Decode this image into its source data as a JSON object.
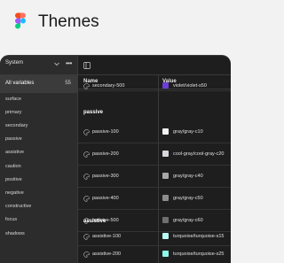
{
  "header": {
    "title": "Themes",
    "logo": "figma-logo"
  },
  "sidebar": {
    "collection": "System",
    "more": "•••",
    "all_variables": {
      "label": "All variables",
      "count": "55"
    },
    "groups": [
      "surface",
      "primary",
      "secondary",
      "passive",
      "assistive",
      "caution",
      "positive",
      "negative",
      "constructive",
      "focus",
      "shadows"
    ]
  },
  "table": {
    "col_name": "Name",
    "col_value": "Value",
    "top_row": {
      "name": "secondary-500",
      "value": "violet/violet-s50",
      "swatch": "#6b3fd4"
    },
    "sections": [
      {
        "title": "passive",
        "rows": [
          {
            "name": "passive-100",
            "value": "gray/gray-c10",
            "swatch": "#f0f0f0"
          },
          {
            "name": "passive-200",
            "value": "cool-gray/cool-gray-c20",
            "swatch": "#d6d8dc"
          },
          {
            "name": "passive-300",
            "value": "gray/gray-c40",
            "swatch": "#a8a8a8"
          },
          {
            "name": "passive-400",
            "value": "gray/gray-c50",
            "swatch": "#8c8c8c"
          },
          {
            "name": "passive-500",
            "value": "gray/gray-c60",
            "swatch": "#6f6f6f"
          }
        ]
      },
      {
        "title": "assistive",
        "rows": [
          {
            "name": "assistive-100",
            "value": "turquoise/turquoise-s15",
            "swatch": "#b8fbf3"
          },
          {
            "name": "assistive-200",
            "value": "turquoise/turquoise-s25",
            "swatch": "#8ff5ea"
          }
        ]
      }
    ]
  }
}
